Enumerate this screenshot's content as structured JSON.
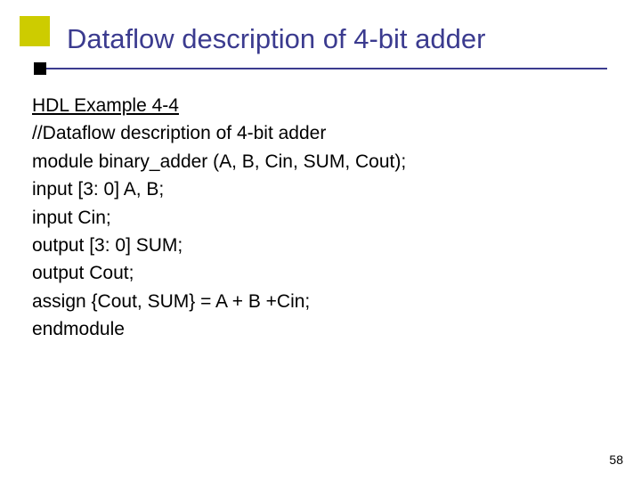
{
  "title": "Dataflow description of 4-bit adder",
  "body": {
    "example_label": "HDL Example 4-4",
    "lines": [
      "//Dataflow description of 4-bit adder",
      "module binary_adder (A, B, Cin, SUM, Cout);",
      "input   [3: 0]   A, B;",
      "input   Cin;",
      "output  [3: 0]  SUM;",
      "output  Cout;",
      "assign  {Cout, SUM} = A + B +Cin;",
      "endmodule"
    ]
  },
  "page_number": "58"
}
